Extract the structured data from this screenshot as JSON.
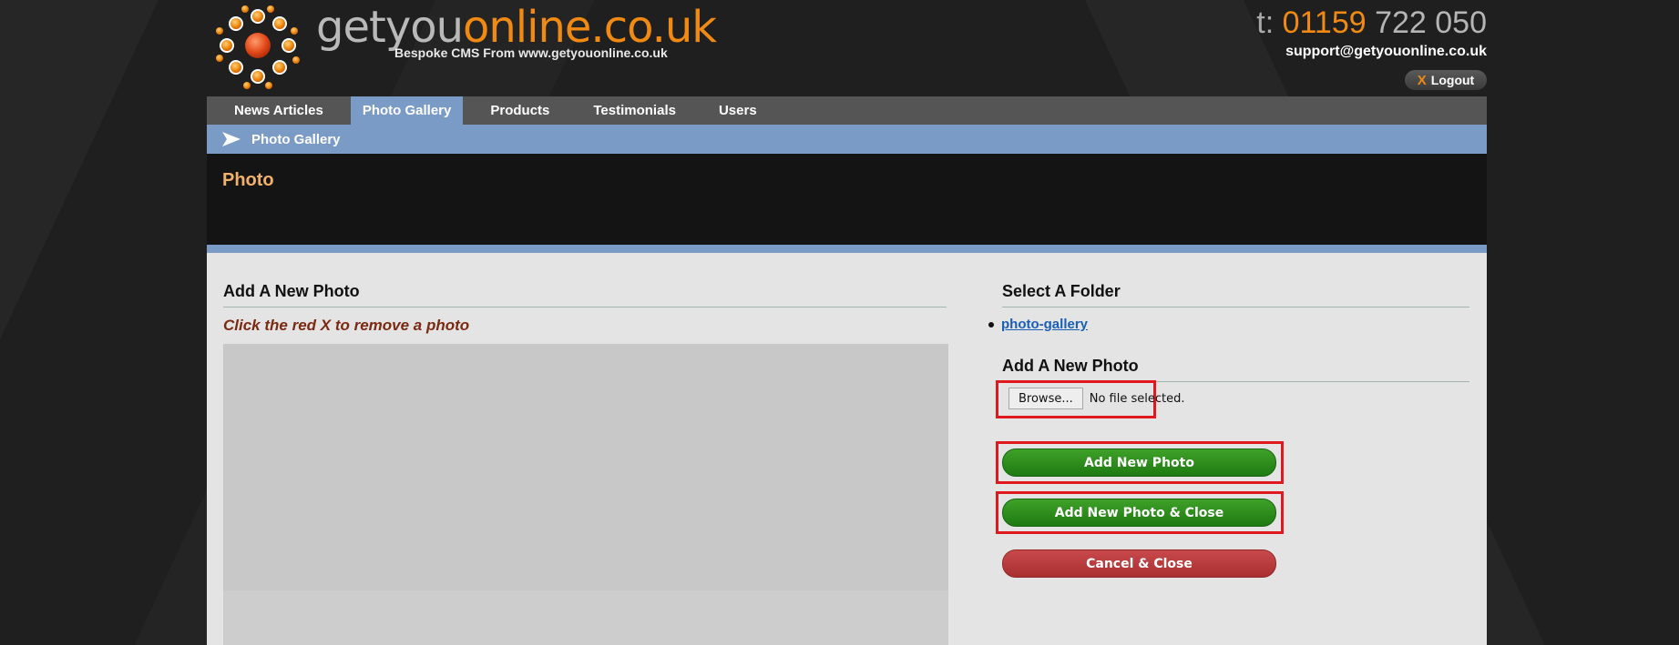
{
  "brand": {
    "name_grey": "getyou",
    "name_orange": "online.co.uk",
    "tagline": "Bespoke CMS From www.getyouonline.co.uk",
    "accent_orange": "#f08a12"
  },
  "contact": {
    "phone_label": "t:",
    "phone_area": "01159",
    "phone_number": " 722 050",
    "email": "support@getyouonline.co.uk"
  },
  "logout": {
    "icon": "X",
    "label": "Logout"
  },
  "nav": {
    "items": [
      {
        "label": "News Articles"
      },
      {
        "label": "Photo Gallery",
        "active": true
      },
      {
        "label": "Products"
      },
      {
        "label": "Testimonials"
      },
      {
        "label": "Users"
      }
    ]
  },
  "breadcrumb": {
    "label": "Photo Gallery"
  },
  "page": {
    "title": "Photo"
  },
  "left": {
    "heading": "Add A New Photo",
    "hint": "Click the red X to remove a photo"
  },
  "right": {
    "folder_heading": "Select A Folder",
    "folders": [
      {
        "label": "photo-gallery"
      }
    ],
    "add_heading": "Add A New Photo",
    "file": {
      "browse_label": "Browse...",
      "status": "No file selected."
    },
    "buttons": {
      "add": "Add New Photo",
      "add_close": "Add New Photo & Close",
      "cancel": "Cancel & Close"
    }
  }
}
